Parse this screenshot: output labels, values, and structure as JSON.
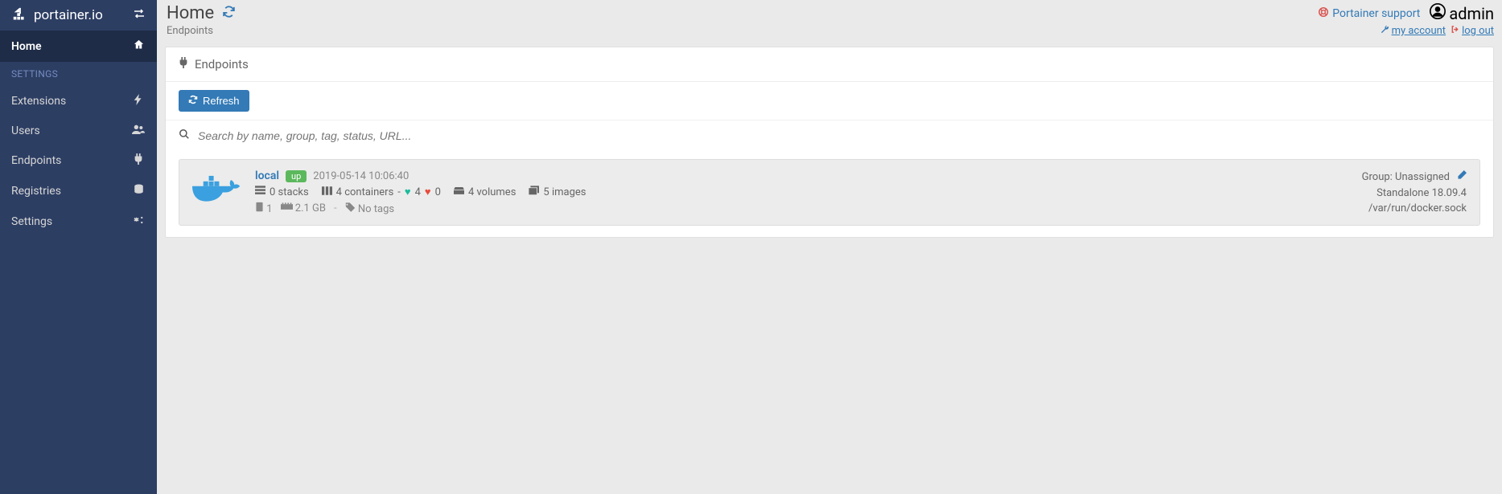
{
  "brand": "portainer.io",
  "sidebar": {
    "home": "Home",
    "sectionLabel": "SETTINGS",
    "items": [
      {
        "label": "Extensions"
      },
      {
        "label": "Users"
      },
      {
        "label": "Endpoints"
      },
      {
        "label": "Registries"
      },
      {
        "label": "Settings"
      }
    ]
  },
  "header": {
    "title": "Home",
    "breadcrumb": "Endpoints",
    "supportLabel": "Portainer support",
    "username": "admin",
    "myAccountLabel": "my account",
    "logoutLabel": "log out"
  },
  "panel": {
    "title": "Endpoints",
    "refreshLabel": "Refresh",
    "searchPlaceholder": "Search by name, group, tag, status, URL..."
  },
  "endpoint": {
    "name": "local",
    "status": "up",
    "timestamp": "2019-05-14 10:06:40",
    "stacks": "0 stacks",
    "containers": "4 containers",
    "healthy": "4",
    "unhealthy": "0",
    "volumes": "4 volumes",
    "images": "5 images",
    "cpus": "1",
    "ram": "2.1 GB",
    "tags": "No tags",
    "groupLabel": "Group: Unassigned",
    "version": "Standalone 18.09.4",
    "socket": "/var/run/docker.sock"
  }
}
